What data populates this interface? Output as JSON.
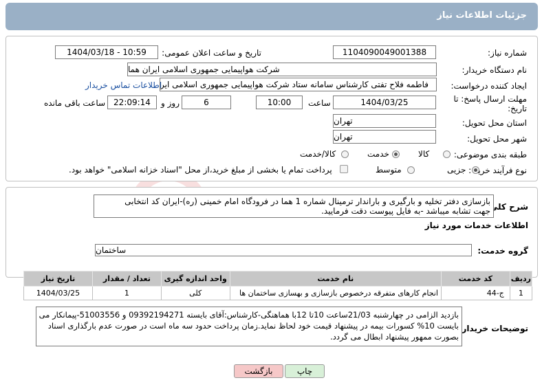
{
  "header": {
    "title": "جزئیات اطلاعات نیاز"
  },
  "form": {
    "need_number_label": "شماره نیاز:",
    "need_number": "1104090049001388",
    "announce_label": "تاریخ و ساعت اعلان عمومی:",
    "announce_value": "1404/03/18 - 10:59",
    "buyer_label": "نام دستگاه خریدار:",
    "buyer_value": "شرکت هواپیمایی جمهوری اسلامی ایران هما",
    "creator_label": "ایجاد کننده درخواست:",
    "creator_value": "فاطمه فلاح تفتی کارشناس سامانه ستاد شرکت هواپیمایی جمهوری اسلامی ایر",
    "contact_link": "اطلاعات تماس خریدار",
    "deadline_label_1": "مهلت ارسال پاسخ: تا",
    "deadline_label_2": "تاریخ:",
    "deadline_date": "1404/03/25",
    "time_label": "ساعت",
    "deadline_time": "10:00",
    "days_count": "6",
    "days_label": "روز و",
    "remaining_time": "22:09:14",
    "remaining_label": "ساعت باقی مانده",
    "province_label": "استان محل تحویل:",
    "province_value": "تهران",
    "city_label": "شهر محل تحویل:",
    "city_value": "تهران",
    "category_label": "طبقه بندی موضوعی:",
    "category_options": [
      "کالا",
      "خدمت",
      "کالا/خدمت"
    ],
    "category_selected": "خدمت",
    "process_label": "نوع فرآیند خرید :",
    "process_options": [
      "جزیی",
      "متوسط"
    ],
    "process_selected": "جزیی",
    "payment_text": "پرداخت تمام یا بخشی از مبلغ خرید،از محل \"اسناد خزانه اسلامی\" خواهد بود."
  },
  "description": {
    "label": "شرح کلی نیاز:",
    "line1": "بازسازی دفتر تخلیه و بارگیری و باراندار ترمینال شماره 1 هما در فرودگاه امام خمینی (ره)-ایران کد انتخابی",
    "line2": "جهت تشابه میباشد -به فایل پیوست دقت فرمایید."
  },
  "services": {
    "section_title": "اطلاعات خدمات مورد نیاز",
    "group_label": "گروه خدمت:",
    "group_value": "ساختمان",
    "columns": [
      "ردیف",
      "کد خدمت",
      "نام خدمت",
      "واحد اندازه گیری",
      "تعداد / مقدار",
      "تاریخ نیاز"
    ],
    "rows": [
      [
        "1",
        "ج-44",
        "انجام کارهای متفرقه درخصوص بازسازی و بهسازی ساختمان ها",
        "کلی",
        "1",
        "1404/03/25"
      ]
    ]
  },
  "buyer_notes": {
    "label": "توضیحات خریدار:",
    "line1": "بازدید الزامی در چهارشنبه 21/03ساعت 10تا 12با هماهنگی-کارشناس:آقای بایسته 09392194271 و 51003556-پیمانکار می",
    "line2": "بایست 10% کسورات بیمه در پیشنهاد قیمت خود لحاظ نماید.زمان پرداخت حدود سه ماه است در صورت عدم بارگذاری اسناد",
    "line3": "بصورت ممهور پیشنهاد ابطال می گردد."
  },
  "buttons": {
    "print": "چاپ",
    "back": "بازگشت"
  },
  "colors": {
    "header": "#9ab0c6",
    "print_btn": "#d8f0d8",
    "back_btn": "#f6c8c8"
  }
}
